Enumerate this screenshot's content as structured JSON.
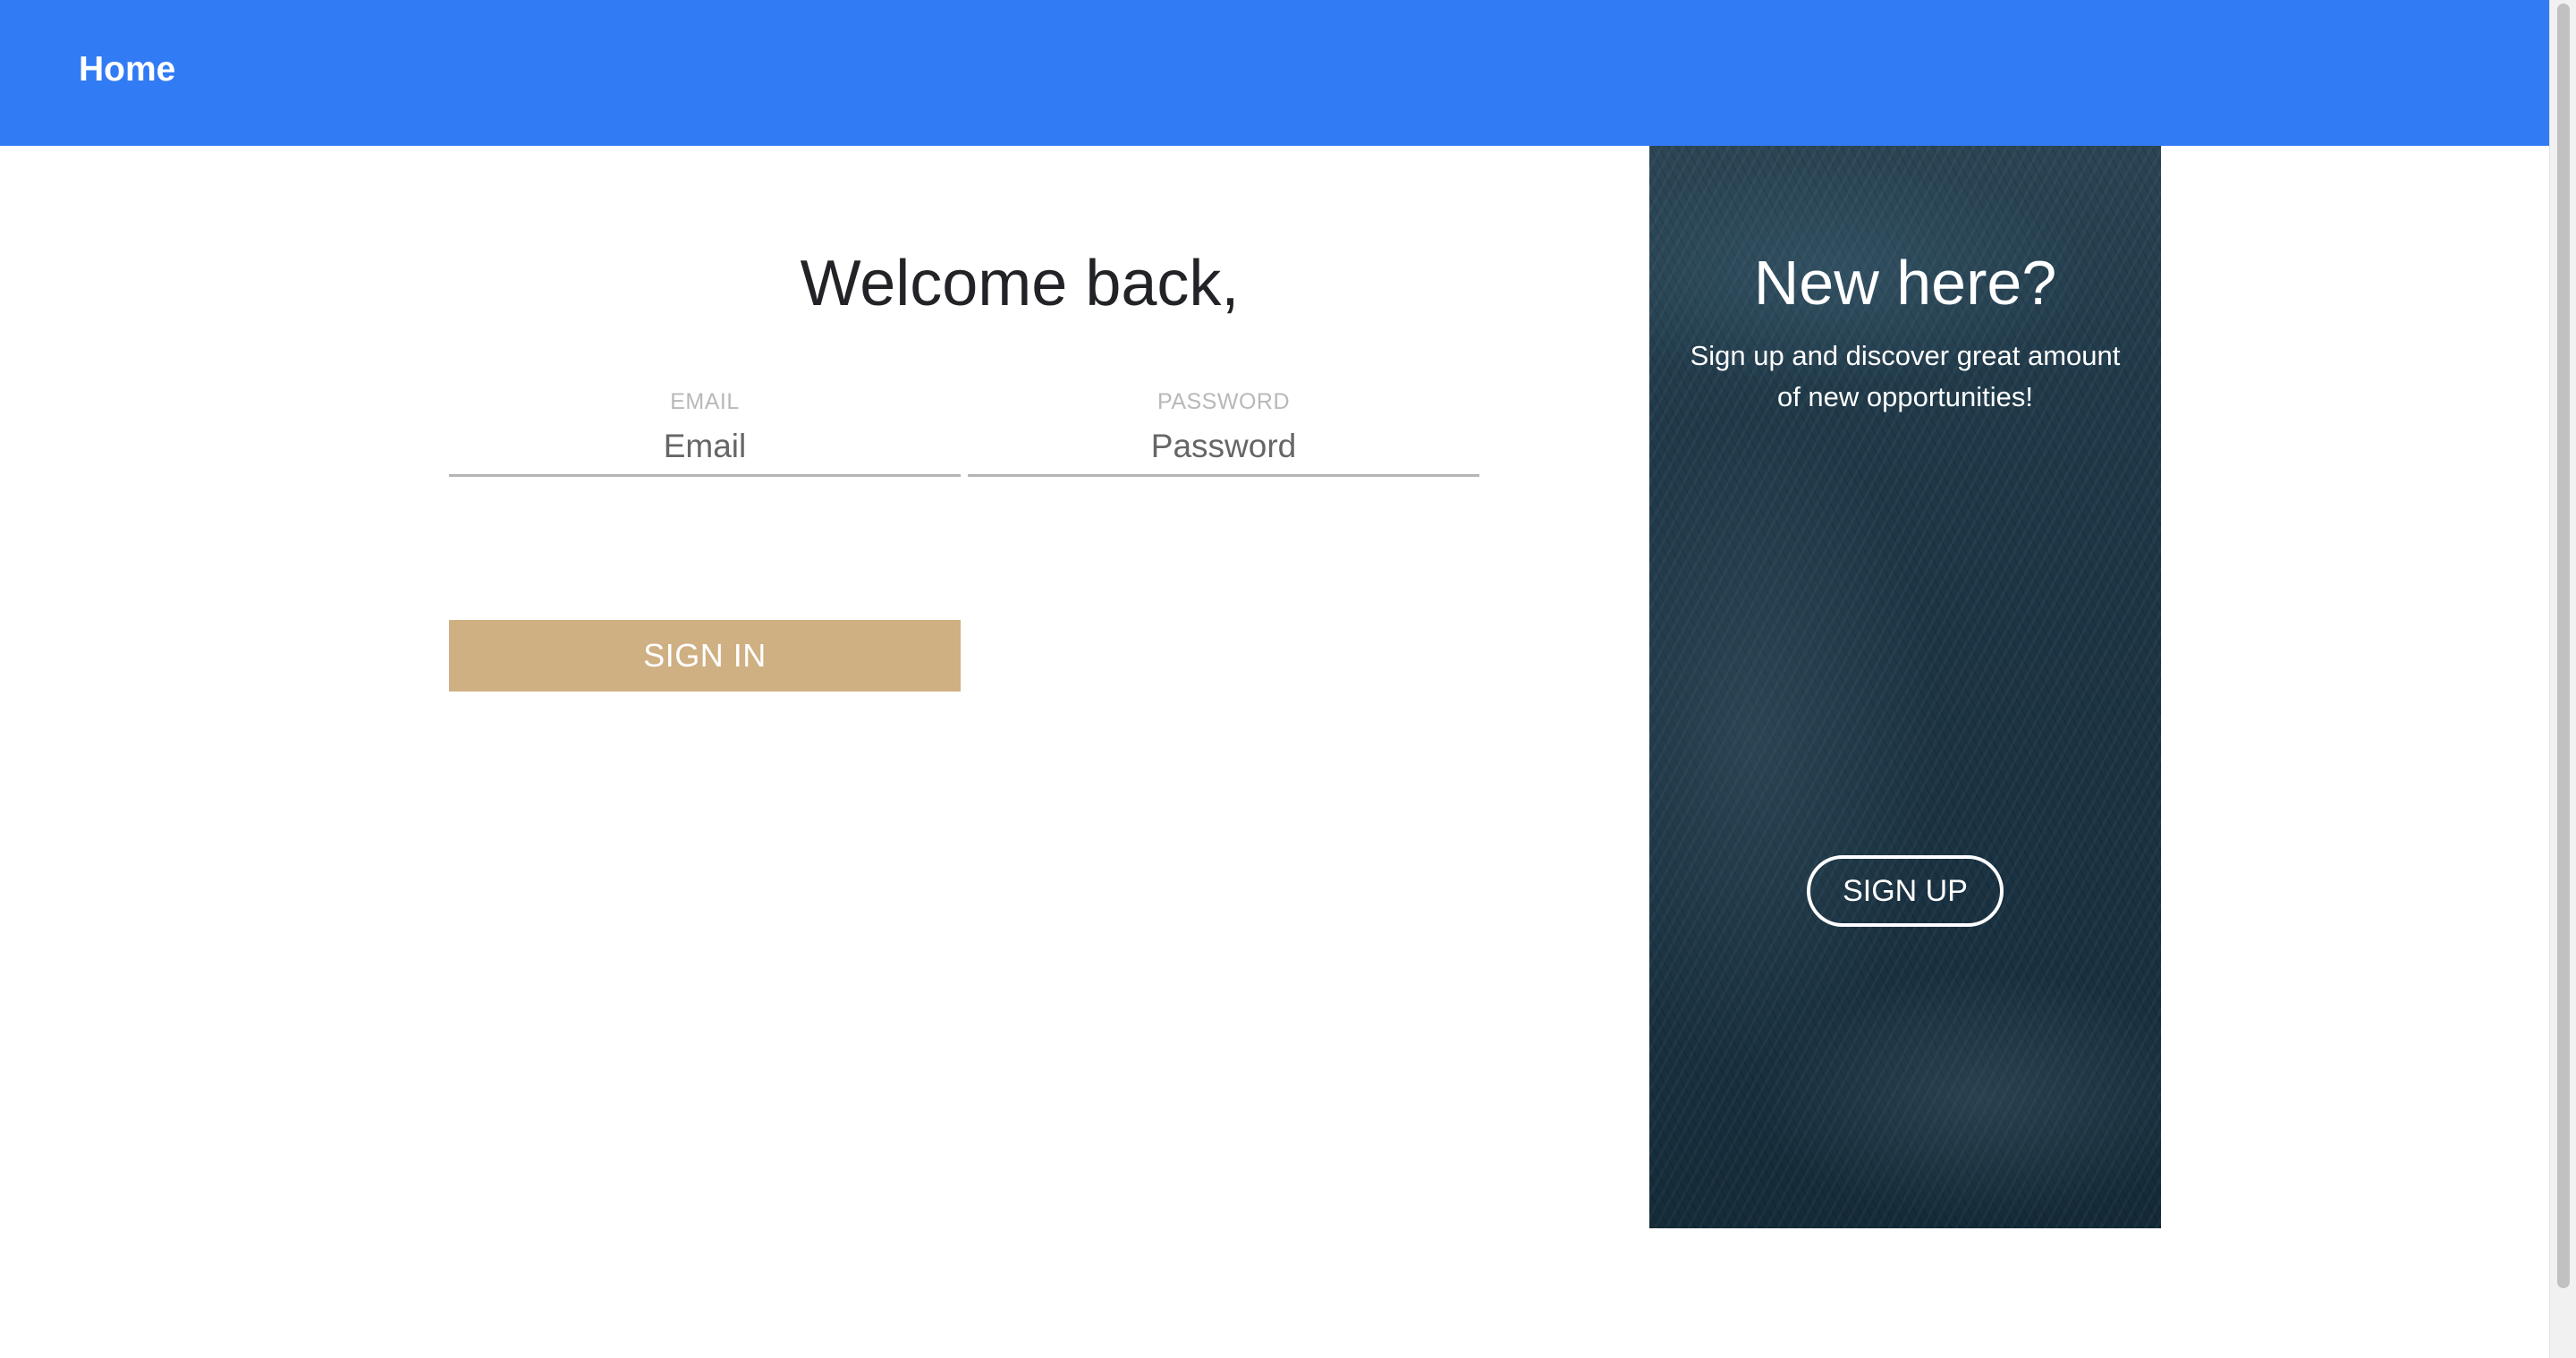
{
  "navbar": {
    "home_label": "Home",
    "background": "#317bf5"
  },
  "signin": {
    "title": "Welcome back,",
    "email_label": "EMAIL",
    "email_placeholder": "Email",
    "email_value": "",
    "password_label": "PASSWORD",
    "password_placeholder": "Password",
    "password_value": "",
    "button_label": "SIGN IN",
    "button_color": "#cfb083"
  },
  "promo": {
    "title": "New here?",
    "text": "Sign up and discover great amount of new opportunities!",
    "button_label": "SIGN UP",
    "background_color": "#1b3343"
  }
}
